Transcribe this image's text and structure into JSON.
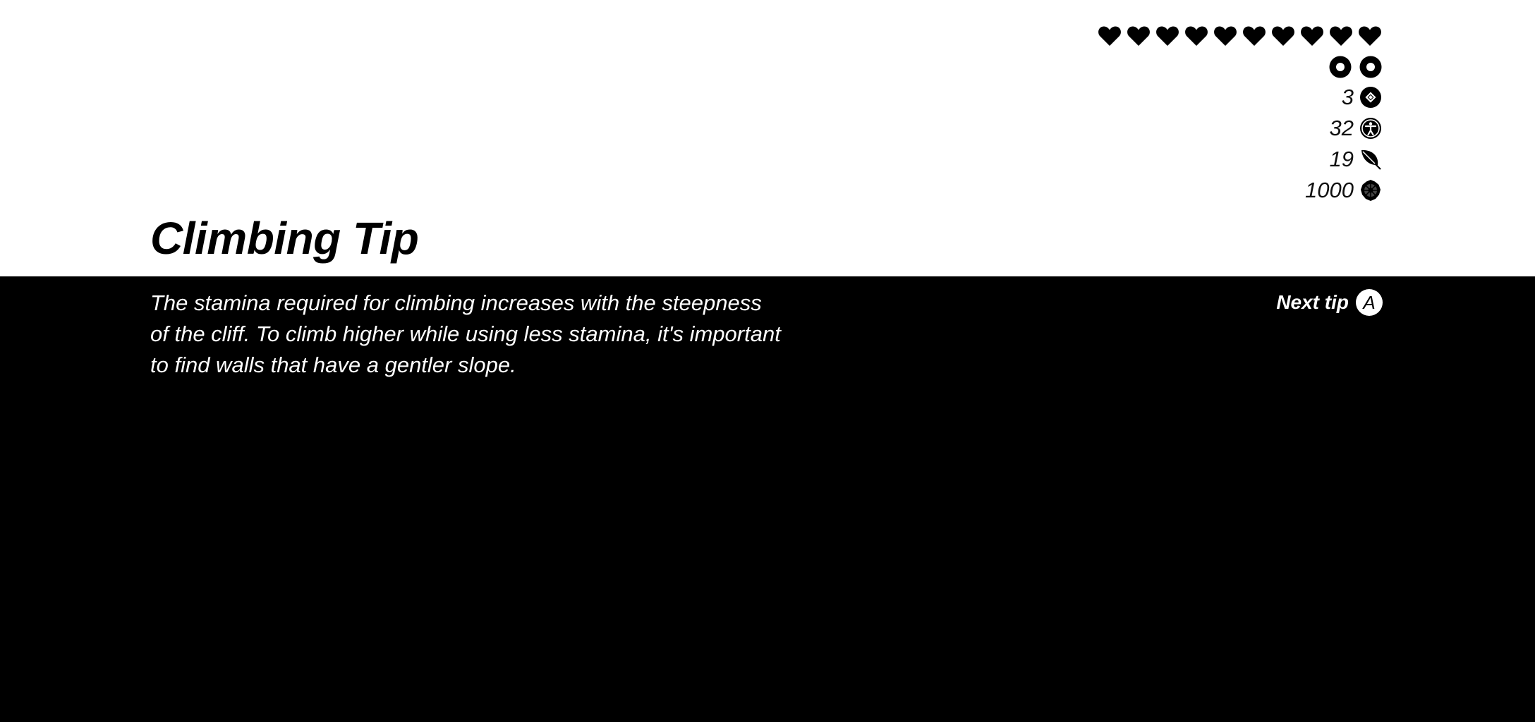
{
  "hud": {
    "hearts_count": 10,
    "stamina_wheels_count": 2,
    "stats": [
      {
        "value": "3",
        "icon": "rupee-gem-icon"
      },
      {
        "value": "32",
        "icon": "figure-icon"
      },
      {
        "value": "19",
        "icon": "leaf-icon"
      },
      {
        "value": "1000",
        "icon": "cog-emblem-icon"
      }
    ]
  },
  "tip": {
    "title": "Climbing Tip",
    "text": "The stamina required for climbing increases with the steepness of the cliff. To climb higher while using less stamina, it's important to find walls that have a gentler slope."
  },
  "next_tip": {
    "label": "Next tip",
    "button": "A"
  },
  "colors": {
    "top_background": "#ffffff",
    "bottom_background": "#000000",
    "icon_color": "#000000"
  }
}
